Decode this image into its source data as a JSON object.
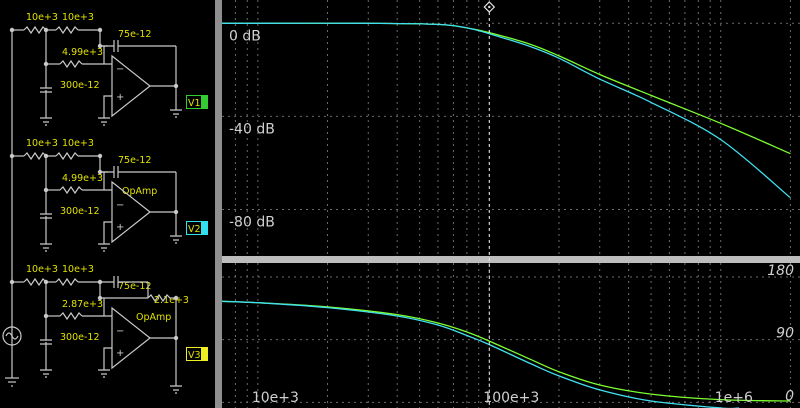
{
  "schematic": {
    "rows": [
      {
        "r1": "10e+3",
        "r2": "10e+3",
        "cap_fb": "75e-12",
        "r_mid": "4.99e+3",
        "cap_gnd": "300e-12",
        "amp_label": "",
        "r_fb": "",
        "probe": "V1",
        "probe_color": "#33cc33"
      },
      {
        "r1": "10e+3",
        "r2": "10e+3",
        "cap_fb": "75e-12",
        "r_mid": "4.99e+3",
        "cap_gnd": "300e-12",
        "amp_label": "OpAmp",
        "r_fb": "",
        "probe": "V2",
        "probe_color": "#33e0f0"
      },
      {
        "r1": "10e+3",
        "r2": "10e+3",
        "cap_fb": "75e-12",
        "r_mid": "2.87e+3",
        "cap_gnd": "300e-12",
        "amp_label": "OpAmp",
        "r_fb": "2.1e+3",
        "probe": "V3",
        "probe_color": "#eeee22"
      }
    ],
    "source_icon": "ac-source-icon"
  },
  "magnitude_plot": {
    "y_labels": [
      "0 dB",
      "-40 dB",
      "-80 dB"
    ],
    "y_values": [
      0,
      -40,
      -80
    ],
    "cursor_icon": "diamond-cursor-icon"
  },
  "phase_plot": {
    "y_labels": [
      "180",
      "90",
      "0"
    ],
    "y_values": [
      180,
      90,
      0
    ],
    "x_labels": [
      "10e+3",
      "100e+3",
      "1e+6"
    ],
    "x_values": [
      10000,
      100000,
      1000000
    ]
  },
  "colors": {
    "wire": "#c9c9c9",
    "component_label": "#e0e000",
    "trace_green": "#7cff30",
    "trace_cyan": "#40e0f0",
    "grid": "#6a6a6a",
    "axis_text": "#d0d0d0"
  },
  "chart_data": [
    {
      "type": "line",
      "title": "",
      "xlabel": "",
      "ylabel": "",
      "x_scale": "log",
      "xlim": [
        7000,
        2200000
      ],
      "ylim": [
        -100,
        10
      ],
      "y_ticks": [
        0,
        -40,
        -80
      ],
      "grid": true,
      "series": [
        {
          "color": "#7cff30",
          "x": [
            7000,
            10000,
            30000,
            60000,
            80000,
            100000,
            150000,
            200000,
            300000,
            500000,
            1000000,
            2000000
          ],
          "values": [
            0,
            0,
            0,
            -0.5,
            -2,
            -4,
            -9,
            -14,
            -22,
            -31,
            -43,
            -56
          ]
        },
        {
          "color": "#40e0f0",
          "x": [
            7000,
            10000,
            30000,
            60000,
            80000,
            100000,
            150000,
            200000,
            300000,
            500000,
            1000000,
            2000000
          ],
          "values": [
            0,
            0,
            0,
            -0.5,
            -2,
            -4.5,
            -10,
            -15,
            -24,
            -34,
            -50,
            -75
          ]
        }
      ]
    },
    {
      "type": "line",
      "title": "",
      "xlabel": "",
      "ylabel": "",
      "x_scale": "log",
      "xlim": [
        7000,
        2200000
      ],
      "ylim": [
        -8,
        200
      ],
      "y_ticks": [
        0,
        90,
        180
      ],
      "x_ticks": [
        10000,
        100000,
        1000000
      ],
      "grid": true,
      "series": [
        {
          "color": "#7cff30",
          "x": [
            7000,
            10000,
            20000,
            40000,
            60000,
            80000,
            100000,
            150000,
            200000,
            300000,
            500000,
            1000000,
            2000000
          ],
          "values": [
            145,
            143,
            137,
            126,
            114,
            101,
            88,
            62,
            44,
            25,
            12,
            4,
            2
          ]
        },
        {
          "color": "#40e0f0",
          "x": [
            7000,
            10000,
            20000,
            40000,
            60000,
            80000,
            100000,
            150000,
            200000,
            300000,
            500000,
            1000000,
            1200000
          ],
          "values": [
            145,
            143,
            136,
            124,
            111,
            96,
            83,
            56,
            38,
            18,
            2,
            -15,
            -22
          ]
        }
      ]
    }
  ]
}
